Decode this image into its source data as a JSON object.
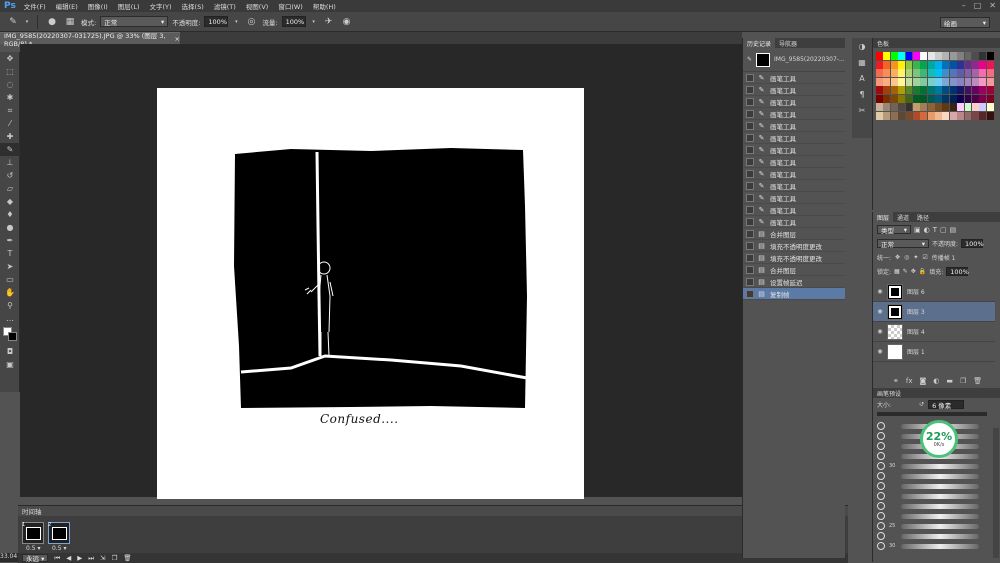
{
  "app": {
    "logo": "Ps"
  },
  "menu": [
    "文件(F)",
    "编辑(E)",
    "图像(I)",
    "图层(L)",
    "文字(Y)",
    "选择(S)",
    "滤镜(T)",
    "视图(V)",
    "窗口(W)",
    "帮助(H)"
  ],
  "options": {
    "mode_label": "模式:",
    "mode_value": "正常",
    "opacity_label": "不透明度:",
    "opacity_value": "100%",
    "flow_label": "流量:",
    "flow_value": "100%",
    "workspace": "绘画"
  },
  "document": {
    "tab_title": "IMG_9585(20220307-031725).JPG @ 33% (图层 3, RGB/8) *",
    "caption": "Confused....",
    "zoom": "33.04"
  },
  "history": {
    "tab_history": "历史记录",
    "tab_navigator": "导航器",
    "snapshot_label": "IMG_9585(20220307-...",
    "items": [
      {
        "label": "画笔工具",
        "icon": "brush"
      },
      {
        "label": "画笔工具",
        "icon": "brush"
      },
      {
        "label": "画笔工具",
        "icon": "brush"
      },
      {
        "label": "画笔工具",
        "icon": "brush"
      },
      {
        "label": "画笔工具",
        "icon": "brush"
      },
      {
        "label": "画笔工具",
        "icon": "brush"
      },
      {
        "label": "画笔工具",
        "icon": "brush"
      },
      {
        "label": "画笔工具",
        "icon": "brush"
      },
      {
        "label": "画笔工具",
        "icon": "brush"
      },
      {
        "label": "画笔工具",
        "icon": "brush"
      },
      {
        "label": "画笔工具",
        "icon": "brush"
      },
      {
        "label": "画笔工具",
        "icon": "brush"
      },
      {
        "label": "画笔工具",
        "icon": "brush"
      },
      {
        "label": "合并图层",
        "icon": "doc"
      },
      {
        "label": "填充不透明度更改",
        "icon": "doc"
      },
      {
        "label": "填充不透明度更改",
        "icon": "doc"
      },
      {
        "label": "合并图层",
        "icon": "doc"
      },
      {
        "label": "设置帧延迟",
        "icon": "doc"
      },
      {
        "label": "复制帧",
        "icon": "doc"
      }
    ]
  },
  "swatches": {
    "tab": "色板"
  },
  "layers": {
    "tab_layers": "图层",
    "tab_channels": "通道",
    "tab_paths": "路径",
    "filter_kind": "类型",
    "blend_mode": "正常",
    "opacity_label": "不透明度:",
    "opacity_value": "100%",
    "unify_label": "统一:",
    "propagate_label": "传播帧 1",
    "lock_label": "锁定:",
    "fill_label": "填充:",
    "fill_value": "100%",
    "items": [
      {
        "name": "图层 6",
        "thumb": "art"
      },
      {
        "name": "图层 3",
        "thumb": "art"
      },
      {
        "name": "图层 4",
        "thumb": "trans"
      },
      {
        "name": "图层 1",
        "thumb": "white"
      }
    ]
  },
  "brushes": {
    "tab": "画笔预设",
    "size_label": "大小:",
    "size_value": "6 像素",
    "sizes": [
      "",
      "",
      "",
      "",
      "30",
      "",
      "",
      "",
      "",
      "",
      "25",
      "",
      "30"
    ]
  },
  "badge": {
    "percent": "22%",
    "speed": "0K/s"
  },
  "timeline": {
    "tab": "时间轴",
    "frames": [
      {
        "num": "1",
        "delay": "0.5 ▾"
      },
      {
        "num": "2",
        "delay": "0.5 ▾"
      }
    ],
    "loop": "永远 ▾"
  }
}
